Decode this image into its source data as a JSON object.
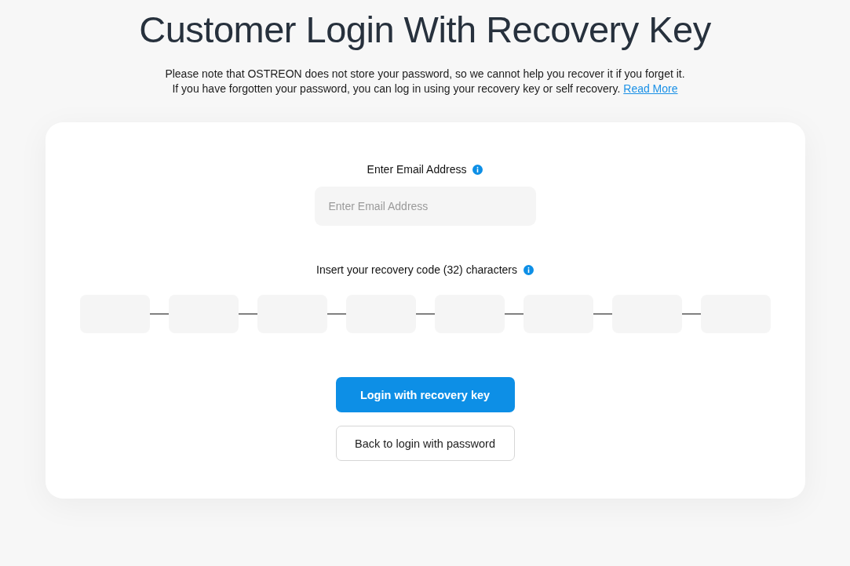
{
  "title": "Customer Login With Recovery Key",
  "notice": [
    "Please note that OSTREON does not store your password, so we cannot help you recover it if you forget it.",
    "If you have forgotten your password, you can log in using your recovery key or self recovery."
  ],
  "notice_link": "Read More",
  "email": {
    "label": "Enter Email Address",
    "placeholder": "Enter Email Address"
  },
  "recovery_code": {
    "label": "Insert your recovery code (32) characters",
    "segments": [
      {
        "kind": "segment"
      },
      {
        "kind": "segment"
      },
      {
        "kind": "segment"
      },
      {
        "kind": "segment"
      },
      {
        "kind": "segment"
      },
      {
        "kind": "segment"
      },
      {
        "kind": "segment"
      },
      {
        "kind": "segment"
      }
    ]
  },
  "buttons": [
    {
      "label": "Login with recovery key",
      "kind": "primary"
    },
    {
      "label": "Back to login with password",
      "kind": "secondary"
    }
  ]
}
